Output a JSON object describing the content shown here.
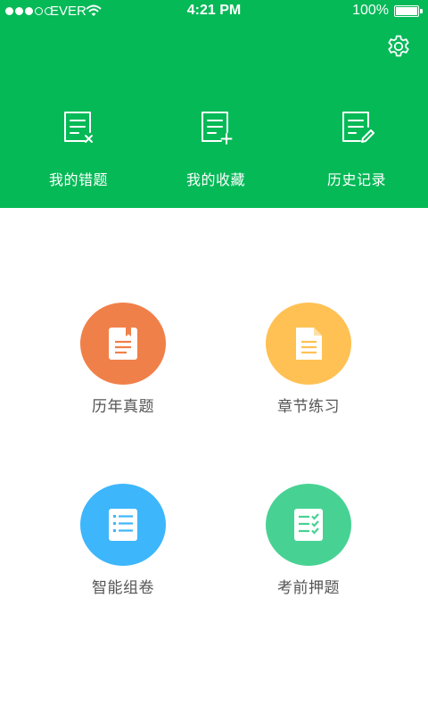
{
  "status_bar": {
    "carrier": "EVER",
    "time": "4:21 PM",
    "battery": "100%"
  },
  "header": {
    "settings_icon": "gear-icon",
    "shortcuts": [
      {
        "label": "我的错题",
        "icon": "document-x-icon"
      },
      {
        "label": "我的收藏",
        "icon": "document-plus-icon"
      },
      {
        "label": "历史记录",
        "icon": "document-edit-icon"
      }
    ]
  },
  "main": {
    "tiles": [
      {
        "label": "历年真题",
        "color": "#f0804a",
        "icon": "bookmark-document-icon"
      },
      {
        "label": "章节练习",
        "color": "#ffc153",
        "icon": "file-icon"
      },
      {
        "label": "智能组卷",
        "color": "#3db6fb",
        "icon": "list-document-icon"
      },
      {
        "label": "考前押题",
        "color": "#47d294",
        "icon": "checklist-icon"
      }
    ]
  },
  "colors": {
    "header_bg": "#05b957",
    "page_bg": "#ffffff",
    "label_text": "#555555"
  }
}
